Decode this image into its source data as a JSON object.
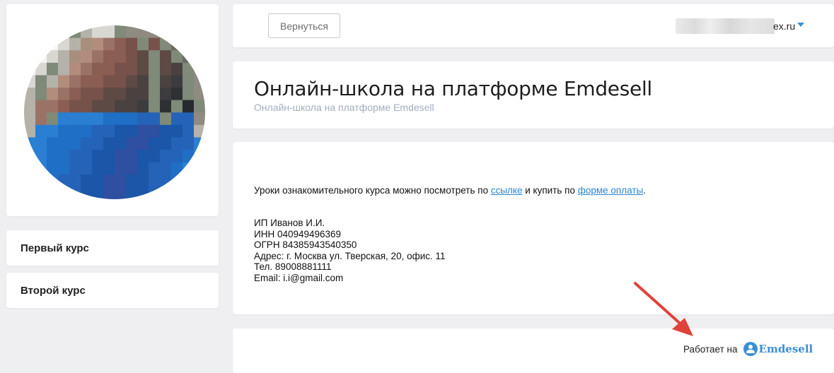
{
  "header": {
    "back_label": "Вернуться",
    "user_email_suffix": "ex.ru"
  },
  "sidebar": {
    "courses": [
      {
        "label": "Первый курс"
      },
      {
        "label": "Второй курс"
      }
    ]
  },
  "school": {
    "title": "Онлайн-школа на платформе Emdesell",
    "subtitle": "Онлайн-школа на платформе Emdesell"
  },
  "content": {
    "intro_prefix": "Уроки ознакомительного курса можно посмотреть по ",
    "link1": "ссылке",
    "intro_middle": " и купить по ",
    "link2": "форме оплаты",
    "intro_suffix": ".",
    "info_lines": [
      "ИП Иванов И.И.",
      "ИНН 040949496369",
      "ОГРН 84385943540350",
      "Адрес: г. Москва ул. Тверская, 20, офис. 11",
      "Тел. 89008881111",
      "Email: i.i@gmail.com"
    ]
  },
  "footer": {
    "powered_by": "Работает на",
    "brand": "Emdesell"
  },
  "colors": {
    "accent": "#3a8fd6",
    "arrow": "#e0423a",
    "background": "#efeff1"
  },
  "icons": {
    "avatar": "avatar-pixelated-photo",
    "caret": "caret-down-icon",
    "logo": "emdesell-logo-icon",
    "arrow": "annotation-arrow"
  }
}
